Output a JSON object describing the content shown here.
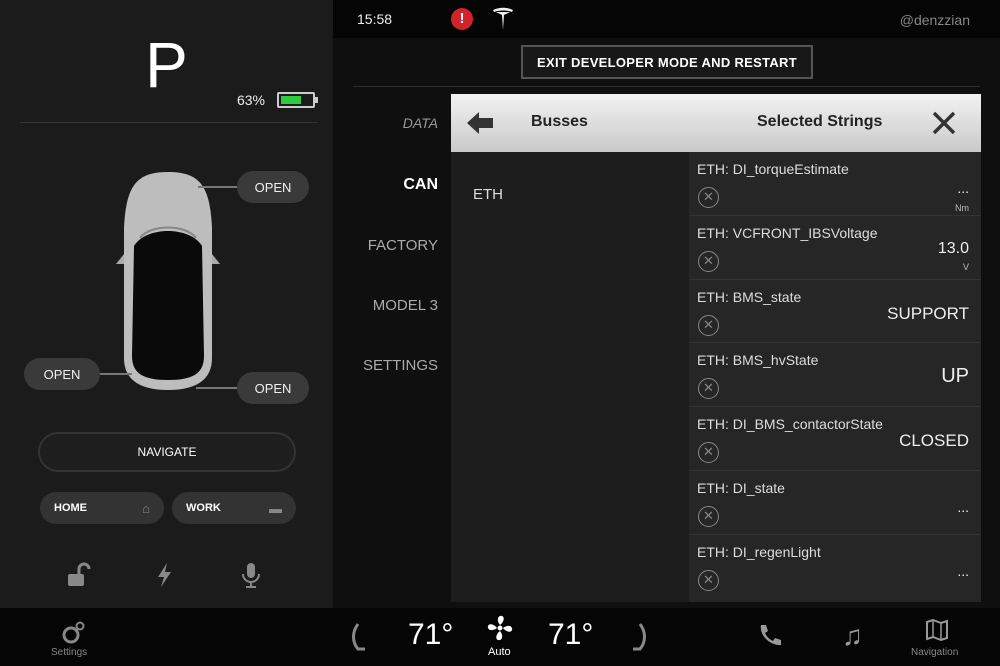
{
  "left": {
    "gear": "P",
    "battery_percent": "63%",
    "battery_level": 0.63,
    "door_labels": [
      "OPEN",
      "OPEN",
      "OPEN"
    ],
    "navigate_label": "NAVIGATE",
    "home_label": "HOME",
    "work_label": "WORK"
  },
  "topbar": {
    "time": "15:58",
    "alert": "!",
    "handle": "@denzzian"
  },
  "main": {
    "exit_button": "EXIT DEVELOPER MODE AND RESTART",
    "menu": [
      "DATA",
      "CAN",
      "FACTORY",
      "MODEL 3",
      "SETTINGS"
    ],
    "selected_menu": "CAN",
    "panel": {
      "busses_title": "Busses",
      "strings_title": "Selected Strings",
      "busses": [
        "ETH"
      ],
      "strings": [
        {
          "name": "ETH: DI_torqueEstimate",
          "value": "...",
          "unit": "Nm"
        },
        {
          "name": "ETH: VCFRONT_IBSVoltage",
          "value": "13.0",
          "unit": "V"
        },
        {
          "name": "ETH: BMS_state",
          "value": "SUPPORT",
          "unit": ""
        },
        {
          "name": "ETH: BMS_hvState",
          "value": "UP",
          "unit": ""
        },
        {
          "name": "ETH: DI_BMS_contactorState",
          "value": "CLOSED",
          "unit": ""
        },
        {
          "name": "ETH: DI_state",
          "value": "...",
          "unit": ""
        },
        {
          "name": "ETH: DI_regenLight",
          "value": "...",
          "unit": ""
        }
      ]
    }
  },
  "bottombar": {
    "settings_label": "Settings",
    "temp_left": "71°",
    "fan_label": "Auto",
    "temp_right": "71°",
    "navigation_label": "Navigation"
  },
  "colors": {
    "battery_green": "#2ecc40",
    "alert_red": "#d0232b"
  }
}
